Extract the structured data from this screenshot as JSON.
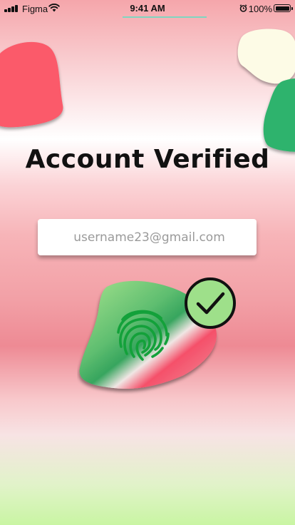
{
  "status_bar": {
    "carrier": "Figma",
    "time": "9:41 AM",
    "battery": "100%",
    "icons": [
      "signal-icon",
      "wifi-icon",
      "alarm-icon",
      "battery-icon"
    ]
  },
  "title": "Account Verified",
  "email_field": {
    "value": "username23@gmail.com"
  },
  "fingerprint": {
    "icon": "fingerprint-icon",
    "badge_icon": "checkmark-icon"
  },
  "colors": {
    "blob_red": "#fb5a6a",
    "blob_cream": "#fdfbe6",
    "blob_green": "#2fb36d",
    "fingerprint_stroke": "#13a13a",
    "badge_fill": "#9ee08a"
  }
}
